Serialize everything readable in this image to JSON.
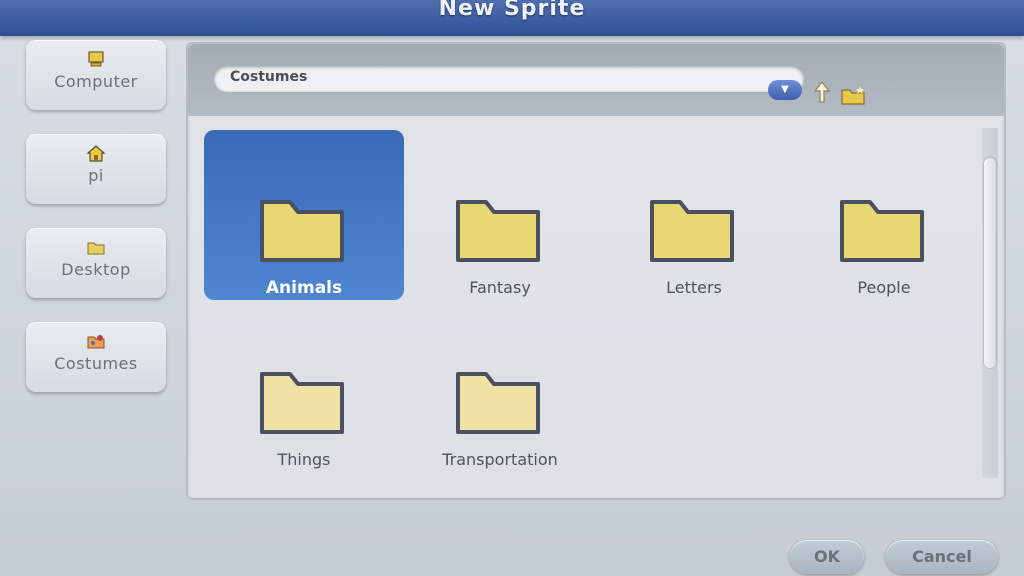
{
  "dialog": {
    "title": "New Sprite"
  },
  "sidebar": {
    "items": [
      {
        "label": "Computer",
        "icon": "computer-icon"
      },
      {
        "label": "pi",
        "icon": "home-icon"
      },
      {
        "label": "Desktop",
        "icon": "desktop-folder-icon"
      },
      {
        "label": "Costumes",
        "icon": "costumes-icon"
      }
    ]
  },
  "pathbar": {
    "current_path": "Costumes"
  },
  "folders": [
    {
      "label": "Animals",
      "selected": true
    },
    {
      "label": "Fantasy",
      "selected": false
    },
    {
      "label": "Letters",
      "selected": false
    },
    {
      "label": "People",
      "selected": false
    },
    {
      "label": "Things",
      "selected": false
    },
    {
      "label": "Transportation",
      "selected": false
    }
  ],
  "buttons": {
    "ok_label": "OK",
    "cancel_label": "Cancel"
  },
  "colors": {
    "title_bar": "#3a5aa0",
    "selection": "#3f73c2",
    "folder_fill": "#e8d873",
    "folder_outline": "#4a5060"
  }
}
